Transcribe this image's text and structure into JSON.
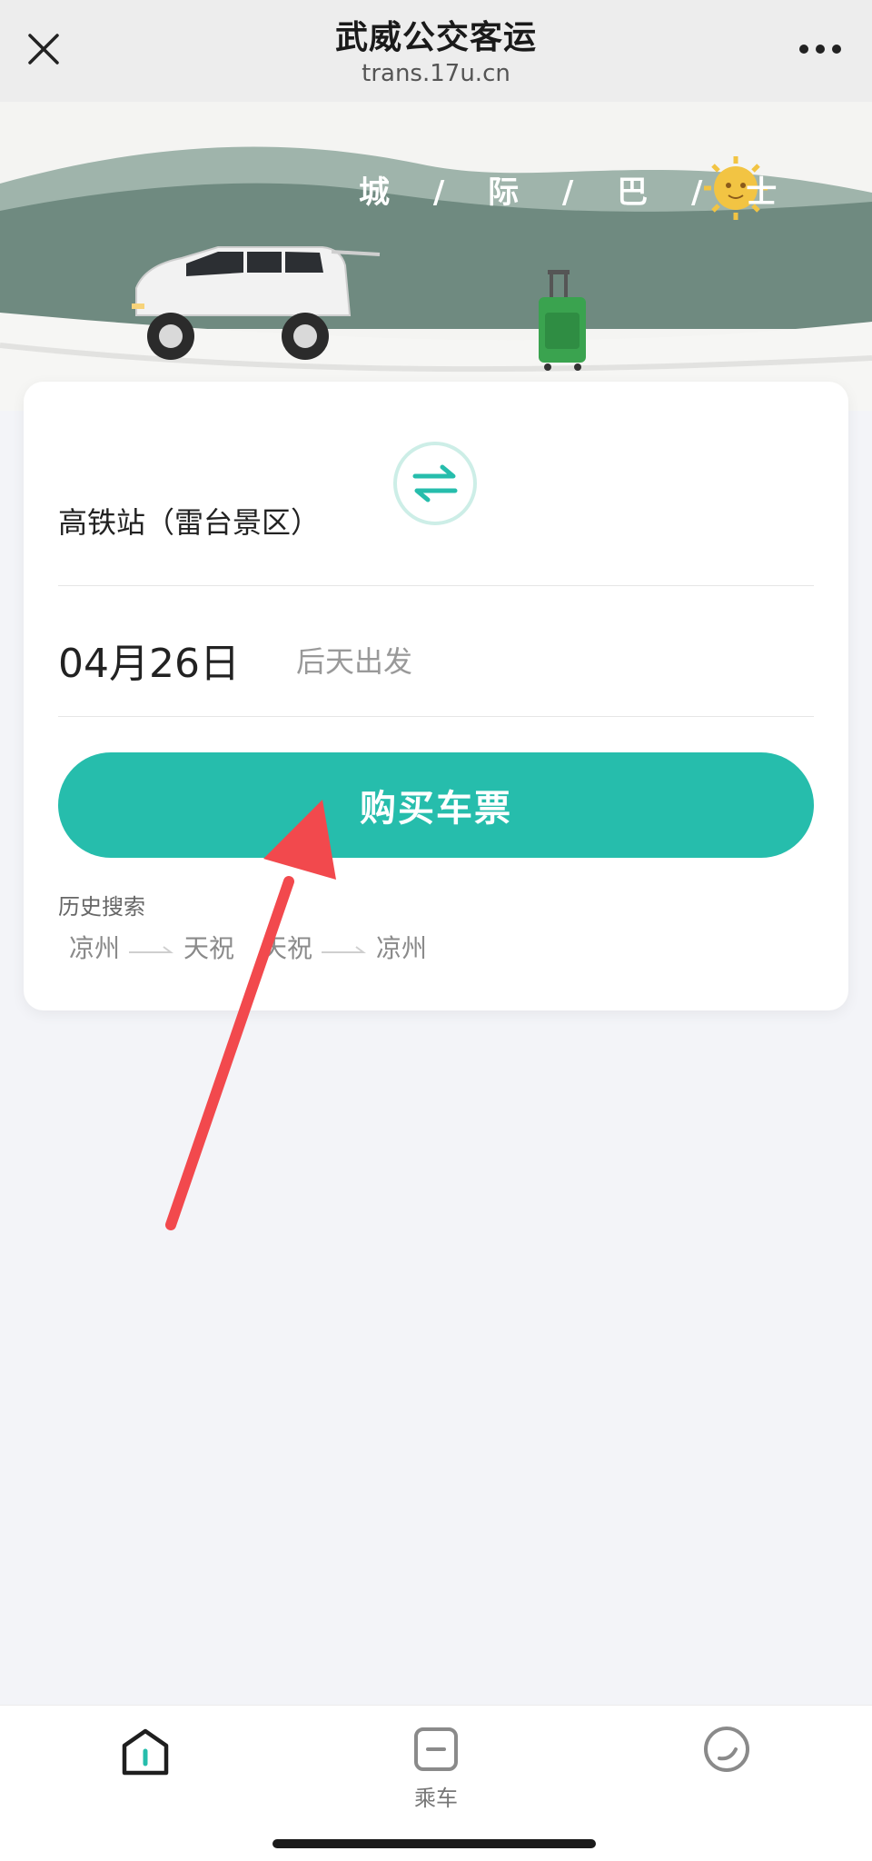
{
  "navbar": {
    "title": "武威公交客运",
    "url": "trans.17u.cn",
    "close_icon": "close-icon",
    "more_icon": "more-dots-icon"
  },
  "banner": {
    "slogan": "城 / 际 / 巴 / 士",
    "accent_color": "#6f8a80"
  },
  "search": {
    "from_station": "高铁站（雷台景区）",
    "to_station": "",
    "swap_icon": "swap-arrows-icon",
    "date": "04月26日",
    "date_hint": "后天出发",
    "buy_button": "购买车票",
    "history_label": "历史搜索",
    "history": [
      {
        "from": "凉州",
        "to": "天祝"
      },
      {
        "from": "天祝",
        "to": "凉州"
      }
    ]
  },
  "tabbar": {
    "tabs": [
      {
        "label": "",
        "icon": "home-icon",
        "active": true
      },
      {
        "label": "乘车",
        "icon": "ticket-icon",
        "active": false
      },
      {
        "label": "",
        "icon": "profile-icon",
        "active": false
      }
    ]
  },
  "colors": {
    "primary": "#26bdac",
    "annotation": "#f2494d"
  }
}
